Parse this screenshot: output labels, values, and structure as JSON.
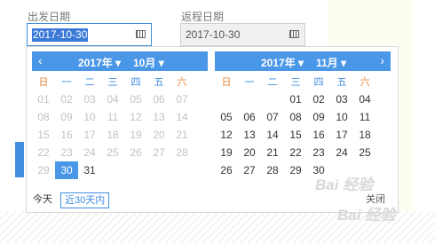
{
  "labels": {
    "depart": "出发日期",
    "return": "返程日期"
  },
  "fields": {
    "depart_value": "2017-10-30",
    "return_value": "2017-10-30"
  },
  "icons": {
    "calendar": "calendar-icon",
    "prev": "chevron-left-icon",
    "next": "chevron-right-icon",
    "dropdown": "caret-down-icon"
  },
  "colors": {
    "accent": "#4a97e8",
    "weekend": "#e8873c",
    "muted": "#c2c2c2"
  },
  "weekdays": [
    "日",
    "一",
    "二",
    "三",
    "四",
    "五",
    "六"
  ],
  "left_calendar": {
    "year": "2017年",
    "month": "10月",
    "weeks": [
      [
        {
          "d": "01",
          "active": false
        },
        {
          "d": "02",
          "active": false
        },
        {
          "d": "03",
          "active": false
        },
        {
          "d": "04",
          "active": false
        },
        {
          "d": "05",
          "active": false
        },
        {
          "d": "06",
          "active": false
        },
        {
          "d": "07",
          "active": false
        }
      ],
      [
        {
          "d": "08",
          "active": false
        },
        {
          "d": "09",
          "active": false
        },
        {
          "d": "10",
          "active": false
        },
        {
          "d": "11",
          "active": false
        },
        {
          "d": "12",
          "active": false
        },
        {
          "d": "13",
          "active": false
        },
        {
          "d": "14",
          "active": false
        }
      ],
      [
        {
          "d": "15",
          "active": false
        },
        {
          "d": "16",
          "active": false
        },
        {
          "d": "17",
          "active": false
        },
        {
          "d": "18",
          "active": false
        },
        {
          "d": "19",
          "active": false
        },
        {
          "d": "20",
          "active": false
        },
        {
          "d": "21",
          "active": false
        }
      ],
      [
        {
          "d": "22",
          "active": false
        },
        {
          "d": "23",
          "active": false
        },
        {
          "d": "24",
          "active": false
        },
        {
          "d": "25",
          "active": false
        },
        {
          "d": "26",
          "active": false
        },
        {
          "d": "27",
          "active": false
        },
        {
          "d": "28",
          "active": false
        }
      ],
      [
        {
          "d": "29",
          "active": false
        },
        {
          "d": "30",
          "active": true,
          "selected": true
        },
        {
          "d": "31",
          "active": true
        },
        {
          "d": ""
        },
        {
          "d": ""
        },
        {
          "d": ""
        },
        {
          "d": ""
        }
      ]
    ]
  },
  "right_calendar": {
    "year": "2017年",
    "month": "11月",
    "weeks": [
      [
        {
          "d": ""
        },
        {
          "d": ""
        },
        {
          "d": ""
        },
        {
          "d": "01",
          "active": true
        },
        {
          "d": "02",
          "active": true
        },
        {
          "d": "03",
          "active": true
        },
        {
          "d": "04",
          "active": true
        }
      ],
      [
        {
          "d": "05",
          "active": true
        },
        {
          "d": "06",
          "active": true
        },
        {
          "d": "07",
          "active": true
        },
        {
          "d": "08",
          "active": true
        },
        {
          "d": "09",
          "active": true
        },
        {
          "d": "10",
          "active": true
        },
        {
          "d": "11",
          "active": true
        }
      ],
      [
        {
          "d": "12",
          "active": true
        },
        {
          "d": "13",
          "active": true
        },
        {
          "d": "14",
          "active": true
        },
        {
          "d": "15",
          "active": true
        },
        {
          "d": "16",
          "active": true
        },
        {
          "d": "17",
          "active": true
        },
        {
          "d": "18",
          "active": true
        }
      ],
      [
        {
          "d": "19",
          "active": true
        },
        {
          "d": "20",
          "active": true
        },
        {
          "d": "21",
          "active": true
        },
        {
          "d": "22",
          "active": true
        },
        {
          "d": "23",
          "active": true
        },
        {
          "d": "24",
          "active": true
        },
        {
          "d": "25",
          "active": true
        }
      ],
      [
        {
          "d": "26",
          "active": true
        },
        {
          "d": "27",
          "active": true
        },
        {
          "d": "28",
          "active": true
        },
        {
          "d": "29",
          "active": true
        },
        {
          "d": "30",
          "active": true
        },
        {
          "d": ""
        },
        {
          "d": ""
        }
      ]
    ]
  },
  "footer": {
    "today": "今天",
    "range": "近30天内",
    "close": "关闭"
  },
  "watermark": {
    "text1": "Bai 经验",
    "text2": "Bai 经验"
  }
}
